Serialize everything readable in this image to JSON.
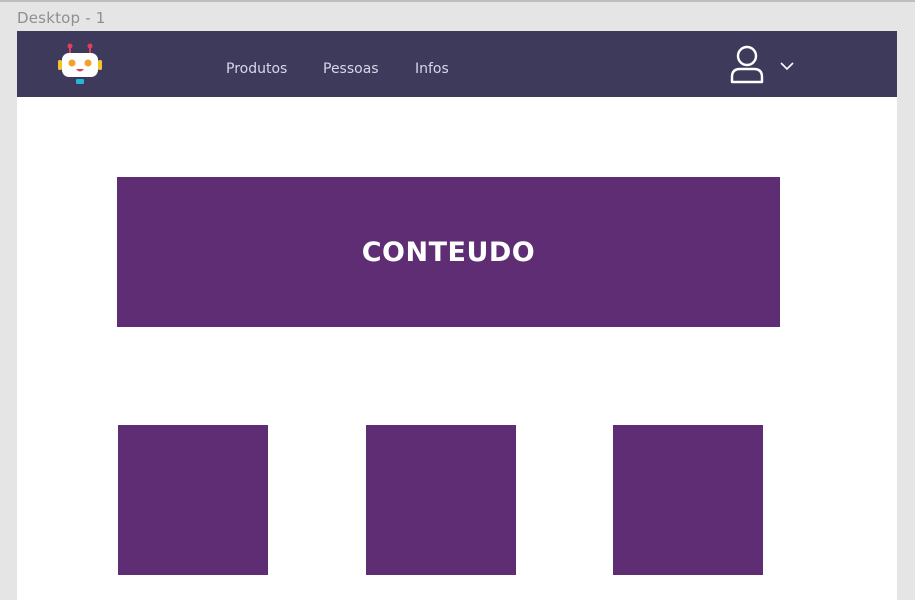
{
  "artboard": {
    "label": "Desktop - 1"
  },
  "navbar": {
    "logo_icon": "robot-icon",
    "links": [
      {
        "label": "Produtos"
      },
      {
        "label": "Pessoas"
      },
      {
        "label": "Infos"
      }
    ],
    "user_icon": "user-icon",
    "menu_icon": "chevron-down-icon"
  },
  "hero": {
    "title": "CONTEUDO"
  },
  "cards": [
    {},
    {},
    {}
  ],
  "colors": {
    "navbar": "#3d3a5c",
    "content_purple": "#5e2d73",
    "canvas": "#e5e5e5",
    "artboard": "#ffffff"
  }
}
